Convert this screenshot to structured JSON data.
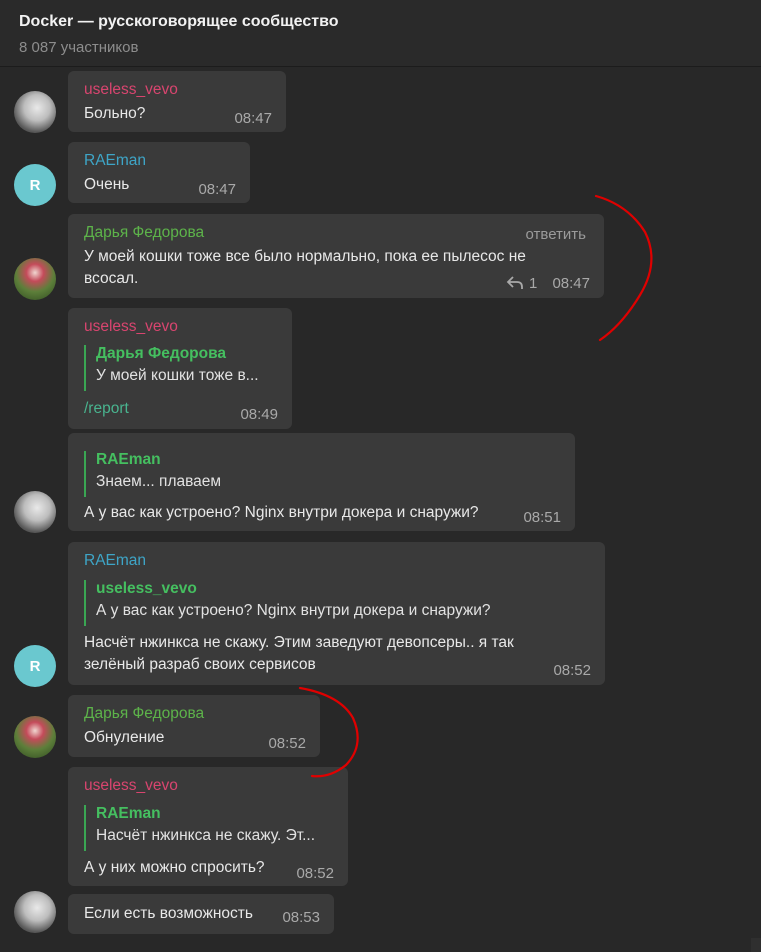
{
  "header": {
    "title": "Docker — русскоговорящее сообщество",
    "subtitle": "8 087 участников"
  },
  "avatars": {
    "useless_letter": "",
    "raeman_letter": "R"
  },
  "messages": [
    {
      "author": "useless_vevo",
      "text": "Больно?",
      "time": "08:47"
    },
    {
      "author": "RAEman",
      "text": "Очень",
      "time": "08:47"
    },
    {
      "author": "Дарья Федорова",
      "action": "ответить",
      "text_line1": "У моей кошки тоже все было нормально, пока ее пылесос не",
      "text_line2": "всосал.",
      "reply_count": "1",
      "time": "08:47"
    },
    {
      "author": "useless_vevo",
      "quote_author": "Дарья Федорова",
      "quote_text": "У моей кошки тоже в...",
      "command": "/report",
      "time": "08:49"
    },
    {
      "quote_author": "RAEman",
      "quote_text": "Знаем... плаваем",
      "text": "А у вас как устроено? Nginx внутри докера и снаружи?",
      "time": "08:51"
    },
    {
      "author": "RAEman",
      "quote_author": "useless_vevo",
      "quote_text": "А у вас как устроено? Nginx внутри докера и снаружи?",
      "text_line1": "Насчёт нжинкса не скажу. Этим заведуют девопсеры.. я так",
      "text_line2": "зелёный разраб своих сервисов",
      "time": "08:52"
    },
    {
      "author": "Дарья Федорова",
      "text": "Обнуление",
      "time": "08:52"
    },
    {
      "author": "useless_vevo",
      "quote_author": "RAEman",
      "quote_text": "Насчёт нжинкса не скажу. Эт...",
      "text": "А у них можно спросить?",
      "time": "08:52"
    },
    {
      "text": "Если есть возможность",
      "time": "08:53"
    }
  ],
  "colors": {
    "background": "#282828",
    "bubble": "#3a3a3a",
    "name_useless": "#d8456f",
    "name_raeman": "#3ea5c7",
    "name_darya": "#5db34a",
    "quote_accent": "#3aa653",
    "annotation": "#e00000"
  },
  "icons": {
    "reply": "reply-arrow-icon"
  }
}
